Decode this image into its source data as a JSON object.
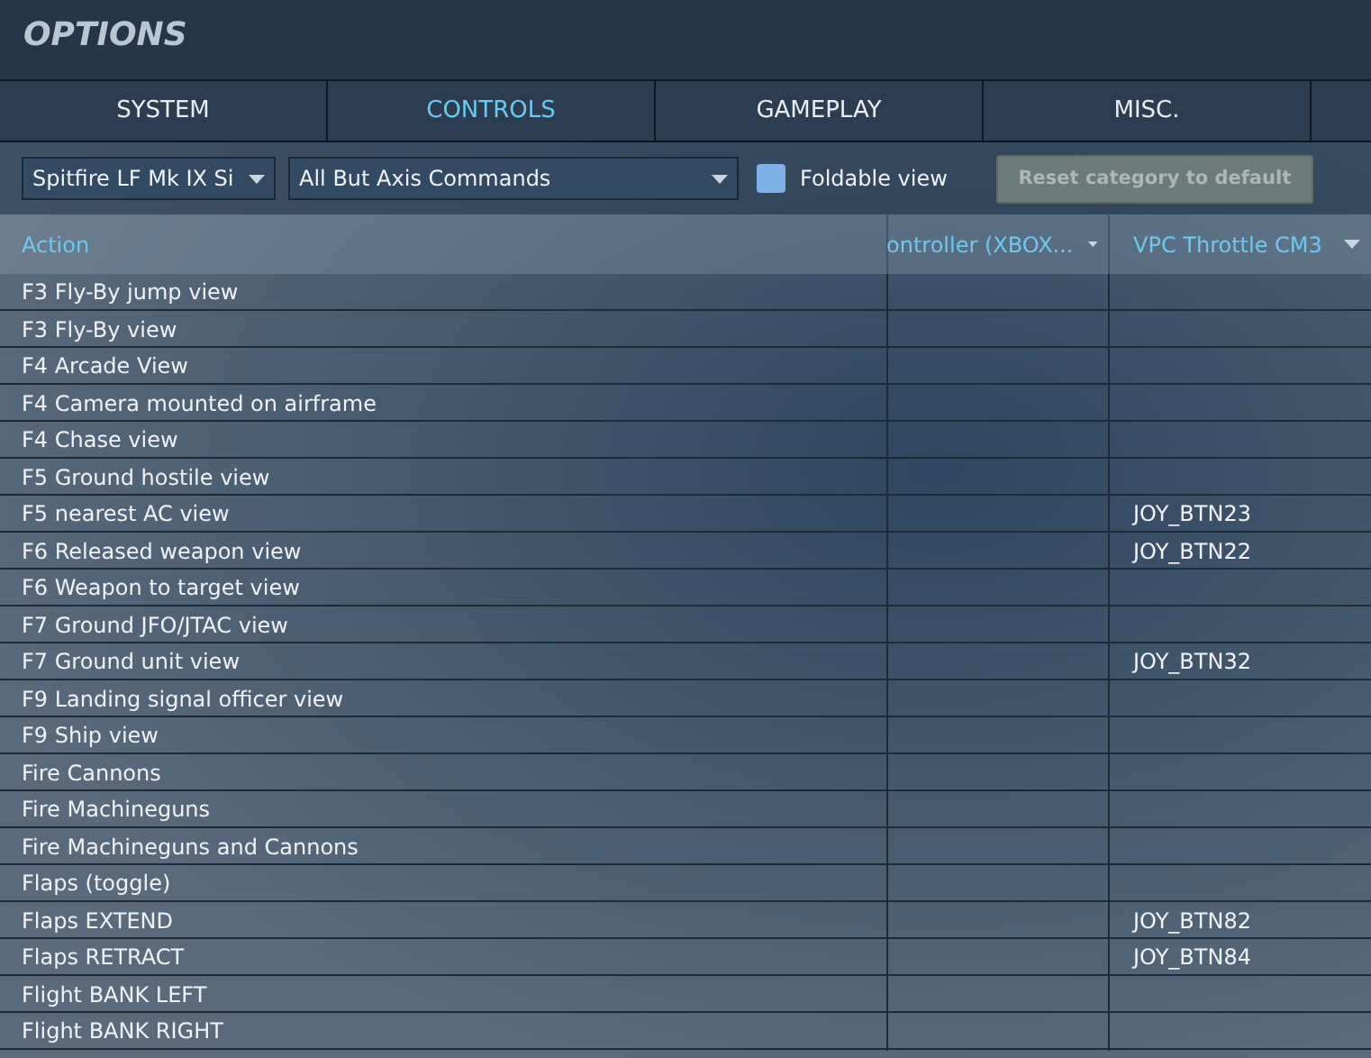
{
  "window": {
    "title": "OPTIONS"
  },
  "tabs": [
    {
      "label": "SYSTEM",
      "selected": false
    },
    {
      "label": "CONTROLS",
      "selected": true
    },
    {
      "label": "GAMEPLAY",
      "selected": false
    },
    {
      "label": "MISC.",
      "selected": false
    }
  ],
  "toolbar": {
    "aircraft_dropdown": {
      "value": "Spitfire LF Mk IX Si"
    },
    "category_dropdown": {
      "value": "All But Axis Commands"
    },
    "foldable_view": {
      "label": "Foldable view",
      "checked": false
    },
    "reset_button": {
      "label": "Reset category to default",
      "disabled": true
    }
  },
  "table": {
    "columns": [
      {
        "label": "Action",
        "dropdown": false
      },
      {
        "label": "ontroller (XBOX...",
        "dropdown": true
      },
      {
        "label": "VPC Throttle CM3",
        "dropdown": true
      }
    ],
    "rows": [
      {
        "action": "F3 Fly-By jump view"
      },
      {
        "action": "F3 Fly-By view"
      },
      {
        "action": "F4 Arcade View"
      },
      {
        "action": "F4 Camera mounted on airframe"
      },
      {
        "action": "F4 Chase view"
      },
      {
        "action": "F5 Ground hostile view"
      },
      {
        "action": "F5 nearest AC view",
        "throttle": "JOY_BTN23"
      },
      {
        "action": "F6 Released weapon view",
        "throttle": "JOY_BTN22"
      },
      {
        "action": "F6 Weapon to target view"
      },
      {
        "action": "F7 Ground JFO/JTAC view"
      },
      {
        "action": "F7 Ground unit view",
        "throttle": "JOY_BTN32"
      },
      {
        "action": "F9 Landing signal officer view"
      },
      {
        "action": "F9 Ship view"
      },
      {
        "action": "Fire Cannons"
      },
      {
        "action": "Fire Machineguns"
      },
      {
        "action": "Fire Machineguns and Cannons"
      },
      {
        "action": "Flaps (toggle)"
      },
      {
        "action": "Flaps EXTEND",
        "throttle": "JOY_BTN82"
      },
      {
        "action": "Flaps RETRACT",
        "throttle": "JOY_BTN84"
      },
      {
        "action": "Flight BANK LEFT"
      },
      {
        "action": "Flight BANK RIGHT"
      }
    ]
  }
}
